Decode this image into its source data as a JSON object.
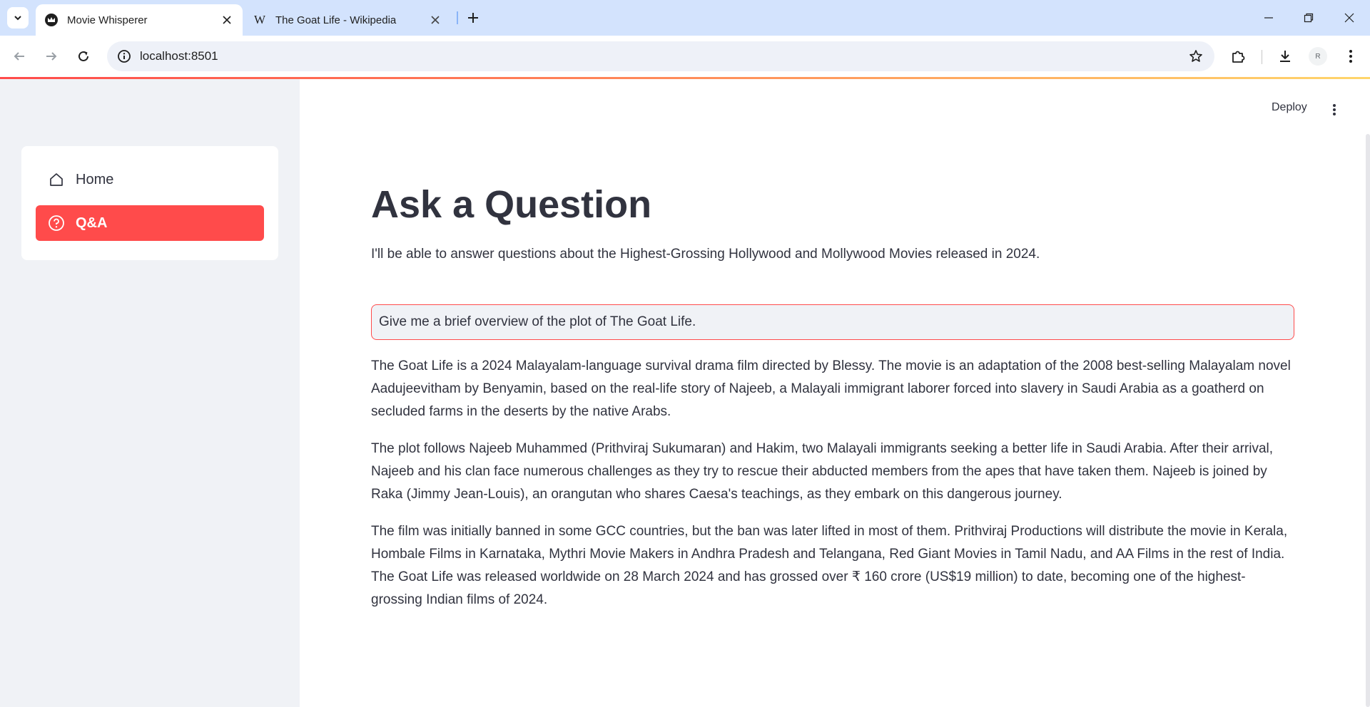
{
  "browser": {
    "tabs": [
      {
        "title": "Movie Whisperer",
        "favicon": "streamlit-crown-icon",
        "active": true
      },
      {
        "title": "The Goat Life - Wikipedia",
        "favicon": "wikipedia-w-icon",
        "active": false
      }
    ],
    "favicon_letter_wikipedia": "W",
    "url": "localhost:8501",
    "avatar_letter": "R"
  },
  "app": {
    "header": {
      "deploy_label": "Deploy"
    },
    "sidebar": {
      "items": [
        {
          "label": "Home",
          "icon": "home-icon",
          "selected": false
        },
        {
          "label": "Q&A",
          "icon": "question-circle-icon",
          "selected": true
        }
      ]
    },
    "main": {
      "title": "Ask a Question",
      "subtitle": "I'll be able to answer questions about the Highest-Grossing Hollywood and Mollywood Movies released in 2024.",
      "question_value": "Give me a brief overview of the plot of The Goat Life.",
      "answer_paragraphs": [
        "The Goat Life is a 2024 Malayalam-language survival drama film directed by Blessy. The movie is an adaptation of the 2008 best-selling Malayalam novel Aadujeevitham by Benyamin, based on the real-life story of Najeeb, a Malayali immigrant laborer forced into slavery in Saudi Arabia as a goatherd on secluded farms in the deserts by the native Arabs.",
        "The plot follows Najeeb Muhammed (Prithviraj Sukumaran) and Hakim, two Malayali immigrants seeking a better life in Saudi Arabia. After their arrival, Najeeb and his clan face numerous challenges as they try to rescue their abducted members from the apes that have taken them. Najeeb is joined by Raka (Jimmy Jean-Louis), an orangutan who shares Caesa's teachings, as they embark on this dangerous journey.",
        "The film was initially banned in some GCC countries, but the ban was later lifted in most of them. Prithviraj Productions will distribute the movie in Kerala, Hombale Films in Karnataka, Mythri Movie Makers in Andhra Pradesh and Telangana, Red Giant Movies in Tamil Nadu, and AA Films in the rest of India. The Goat Life was released worldwide on 28 March 2024 and has grossed over ₹ 160 crore (US$19 million) to date, becoming one of the highest-grossing Indian films of 2024."
      ]
    }
  },
  "colors": {
    "accent": "#ff4b4b",
    "sidebar_bg": "#f0f2f6",
    "tabbar_bg": "#d3e3fd",
    "text": "#31333f"
  }
}
